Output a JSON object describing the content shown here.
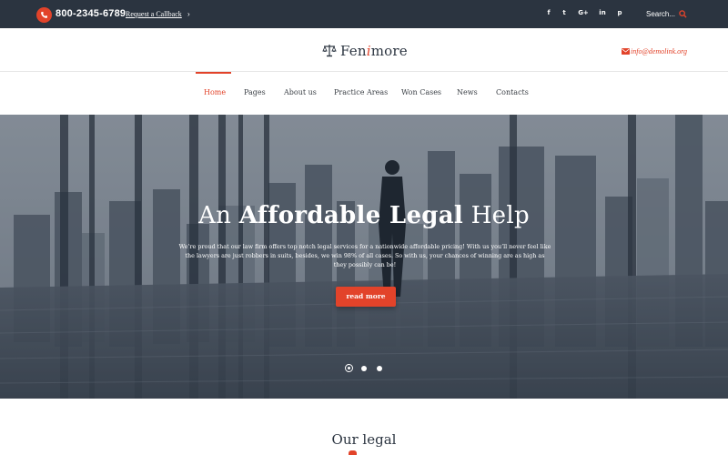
{
  "topbar": {
    "phone": "800-2345-6789",
    "callback": "Request a Callback",
    "callback_arrow": "›",
    "social": [
      {
        "name": "facebook-icon",
        "glyph": "f"
      },
      {
        "name": "twitter-icon",
        "glyph": "t"
      },
      {
        "name": "google-plus-icon",
        "glyph": "G+"
      },
      {
        "name": "linkedin-icon",
        "glyph": "in"
      },
      {
        "name": "pinterest-icon",
        "glyph": "p"
      }
    ],
    "search_placeholder": "Search..."
  },
  "header": {
    "logo_part1": "Fen",
    "logo_accent": "i",
    "logo_part2": "more",
    "email": "info@demolink.org"
  },
  "nav": {
    "items": [
      {
        "label": "Home",
        "active": true
      },
      {
        "label": "Pages"
      },
      {
        "label": "About us"
      },
      {
        "label": "Practice Areas"
      },
      {
        "label": "Won Cases"
      },
      {
        "label": "News"
      },
      {
        "label": "Contacts"
      }
    ]
  },
  "hero": {
    "title_prefix": "An ",
    "title_bold": "Affordable Legal",
    "title_suffix": " Help",
    "text": "We’re proud that our law firm offers top notch legal services for a nationwide affordable pricing! With us you’ll never feel like the lawyers are just robbers in suits, besides, we win 98% of all cases. So with us, your chances of winning are as high as they possibly can be!",
    "button": "read more",
    "slides": 3,
    "active_slide": 1
  },
  "section": {
    "title": "Our legal"
  },
  "colors": {
    "accent": "#e2432a",
    "topbar": "#2b3440"
  }
}
